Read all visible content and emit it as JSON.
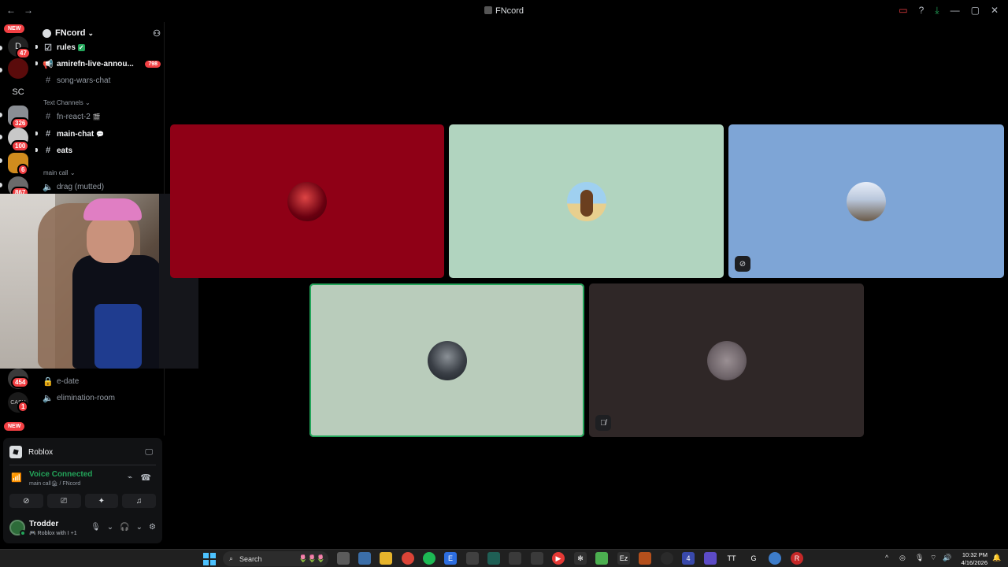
{
  "window": {
    "title": "FNcord",
    "nav_back": "←",
    "nav_forward": "→",
    "controls": [
      "▭",
      "?",
      "⤓",
      "—",
      "▢",
      "✕"
    ]
  },
  "rail": {
    "badges": [
      {
        "text": "NEW",
        "kind": "new"
      },
      {
        "text": "47"
      },
      {
        "text": "326"
      },
      {
        "text": "100"
      },
      {
        "text": "6"
      },
      {
        "text": "867"
      },
      {
        "text": "454"
      },
      {
        "text": "1"
      },
      {
        "text": "NEW",
        "kind": "new"
      }
    ],
    "sc_label": "SC"
  },
  "server": {
    "name": "FNcord",
    "channels_top": [
      {
        "name": "rules",
        "emoji": "✓",
        "icon": "rules-icon",
        "unread": true
      },
      {
        "name": "amirefn-live-annou...",
        "icon": "announcement-icon",
        "unread": true,
        "mentions": "798"
      },
      {
        "name": "song-wars-chat",
        "icon": "hash-icon",
        "unread": false
      }
    ],
    "category_text": "Text Channels",
    "text_channels": [
      {
        "name": "fn-react-2",
        "emoji": "🎬",
        "unread": false
      },
      {
        "name": "main-chat",
        "emoji": "💬",
        "unread": true
      },
      {
        "name": "eats",
        "emoji": "",
        "unread": true
      }
    ],
    "category_call": "main call",
    "voice_channels": [
      {
        "name": "drag (mutted)"
      }
    ],
    "lower_channels": [
      {
        "name": "e-date",
        "icon": "lock-icon"
      },
      {
        "name": "elimination-room",
        "icon": "speaker-icon"
      }
    ]
  },
  "panel": {
    "activity": "Roblox",
    "voice_status": "Voice Connected",
    "voice_sub": "main call🏚 / FNcord",
    "user_name": "Trodder",
    "user_activity": "🎮 Roblox with I +1"
  },
  "tiles": [
    {
      "bg": "#8f0016",
      "speaking": false,
      "status": ""
    },
    {
      "bg": "#b1d4bf",
      "speaking": false,
      "status": ""
    },
    {
      "bg": "#7ea5d6",
      "speaking": false,
      "status": "video-off"
    },
    {
      "bg": "#b9ccbb",
      "speaking": true,
      "status": ""
    },
    {
      "bg": "#2f2727",
      "speaking": false,
      "status": "muted"
    }
  ],
  "taskbar": {
    "search": "Search",
    "time": "10:32 PM",
    "date": "4/16/2026"
  },
  "colors": {
    "accent_green": "#23a55a",
    "alert_red": "#f23f43",
    "background": "#000000"
  }
}
